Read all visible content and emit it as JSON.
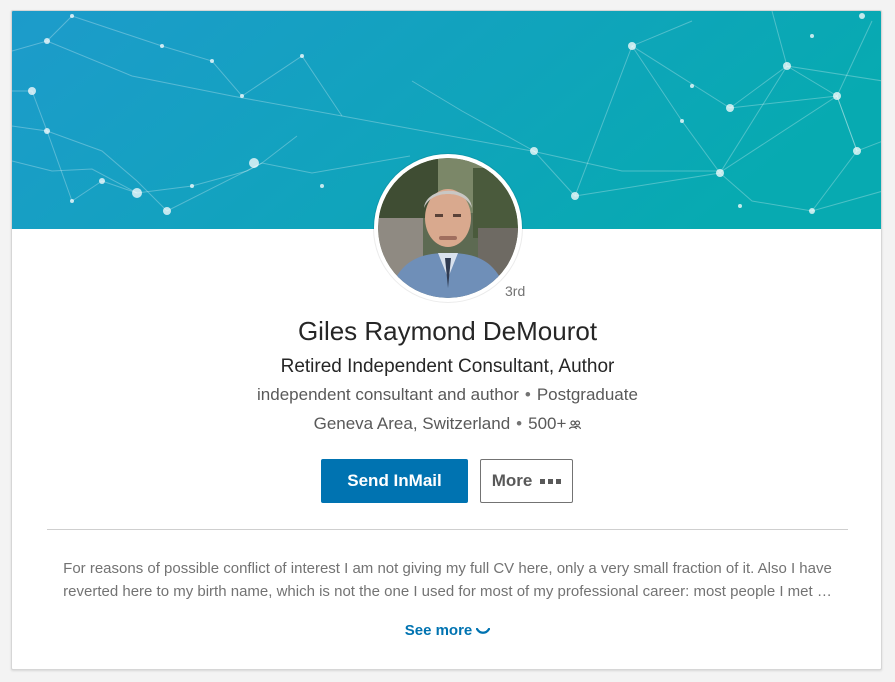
{
  "profile": {
    "name": "Giles Raymond DeMourot",
    "degree": "3rd",
    "headline": "Retired Independent Consultant, Author",
    "company": "independent consultant and author",
    "education": "Postgraduate",
    "location": "Geneva Area, Switzerland",
    "connections": "500+",
    "separator": "•"
  },
  "actions": {
    "send_inmail": "Send InMail",
    "more": "More"
  },
  "summary": {
    "line1": "For reasons of possible conflict of interest I am not giving my full CV here, only a very small fraction of it. Also I have",
    "line2": "reverted here to my birth name, which is not the one I used for most of my professional career: most people I met …",
    "see_more": "See more"
  },
  "colors": {
    "banner_start": "#1b9ec9",
    "banner_end": "#08a9b1",
    "primary": "#0073b1"
  },
  "icons": {
    "connections": "connections-icon",
    "more": "ellipsis-icon",
    "see_more": "chevron-down-icon"
  }
}
